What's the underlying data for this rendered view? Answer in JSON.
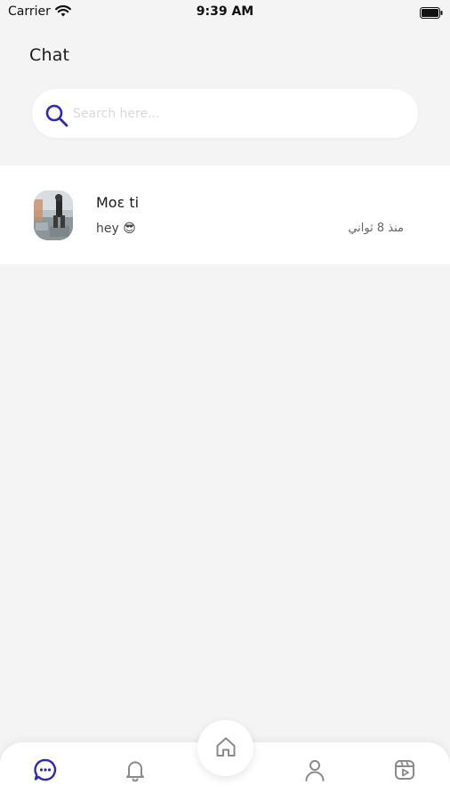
{
  "status_bar": {
    "carrier": "Carrier",
    "time": "9:39 AM",
    "wifi_icon": "wifi-icon",
    "battery_icon": "battery-icon"
  },
  "header": {
    "title": "Chat"
  },
  "search": {
    "placeholder": "Search here...",
    "value": "",
    "icon": "search-icon"
  },
  "chats": [
    {
      "name": "Moɛ ti",
      "preview": "hey 😎",
      "time": "منذ 8 ثواني",
      "avatar": "avatar-photo"
    }
  ],
  "bottom_nav": {
    "items": [
      {
        "icon": "chat-icon",
        "active": true
      },
      {
        "icon": "bell-icon",
        "active": false
      },
      {
        "icon": "home-icon",
        "active": false
      },
      {
        "icon": "person-icon",
        "active": false
      },
      {
        "icon": "video-icon",
        "active": false
      }
    ]
  },
  "colors": {
    "background": "#f4f4f4",
    "accent": "#2e2ab3",
    "surface": "#ffffff",
    "placeholder": "#d8d8d8",
    "icon_muted": "#8a8a8a"
  }
}
